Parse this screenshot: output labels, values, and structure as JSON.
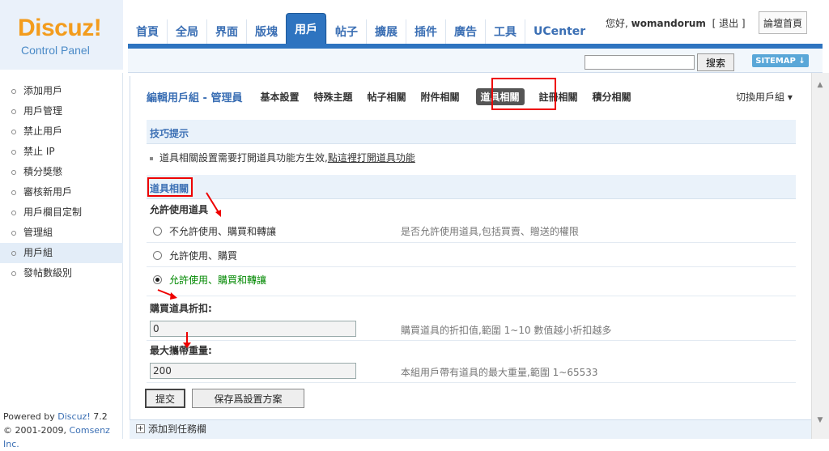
{
  "logo": {
    "brand": "Discuz!",
    "subtitle": "Control Panel"
  },
  "nav": {
    "items": [
      {
        "label": "首頁",
        "active": false
      },
      {
        "label": "全局",
        "active": false
      },
      {
        "label": "界面",
        "active": false
      },
      {
        "label": "版塊",
        "active": false
      },
      {
        "label": "用戶",
        "active": true
      },
      {
        "label": "帖子",
        "active": false
      },
      {
        "label": "擴展",
        "active": false
      },
      {
        "label": "插件",
        "active": false
      },
      {
        "label": "廣告",
        "active": false
      },
      {
        "label": "工具",
        "active": false
      },
      {
        "label": "UCenter",
        "active": false
      }
    ]
  },
  "user": {
    "greeting": "您好,",
    "name": "womandorum",
    "logout": "[ 退出 ]",
    "forum_home": "論壇首頁"
  },
  "search": {
    "value": "",
    "button": "搜索",
    "sitemap": "SITEMAP ↓"
  },
  "sidebar": {
    "items": [
      {
        "label": "添加用戶",
        "active": false
      },
      {
        "label": "用戶管理",
        "active": false
      },
      {
        "label": "禁止用戶",
        "active": false
      },
      {
        "label": "禁止 IP",
        "active": false
      },
      {
        "label": "積分獎懲",
        "active": false
      },
      {
        "label": "審核新用戶",
        "active": false
      },
      {
        "label": "用戶欄目定制",
        "active": false
      },
      {
        "label": "管理組",
        "active": false
      },
      {
        "label": "用戶組",
        "active": true
      },
      {
        "label": "發帖數級別",
        "active": false
      }
    ],
    "powered_prefix": "Powered by ",
    "powered_brand": "Discuz!",
    "powered_version": " 7.2",
    "copyright_prefix": "© 2001-2009, ",
    "copyright_company": "Comsenz Inc."
  },
  "main": {
    "title": "編輯用戶組 - 管理員",
    "tabs": [
      {
        "label": "基本設置",
        "active": false
      },
      {
        "label": "特殊主題",
        "active": false
      },
      {
        "label": "帖子相關",
        "active": false
      },
      {
        "label": "附件相關",
        "active": false
      },
      {
        "label": "道具相關",
        "active": true
      },
      {
        "label": "註冊相關",
        "active": false
      },
      {
        "label": "積分相關",
        "active": false
      }
    ],
    "switch_group": "切換用戶組 ▾",
    "tip_title": "技巧提示",
    "tip_text": "道具相關設置需要打開道具功能方生效,",
    "tip_link": "點這裡打開道具功能",
    "section_title": "道具相關",
    "allow_label": "允許使用道具",
    "options": [
      {
        "label": "不允許使用、購買和轉讓",
        "checked": false
      },
      {
        "label": "允許使用、購買",
        "checked": false
      },
      {
        "label": "允許使用、購買和轉讓",
        "checked": true
      }
    ],
    "allow_hint": "是否允許使用道具,包括買賣、贈送的權限",
    "discount_label": "購買道具折扣:",
    "discount_value": "0",
    "discount_hint": "購買道具的折扣值,範圍 1~10 數值越小折扣越多",
    "weight_label": "最大攜帶重量:",
    "weight_value": "200",
    "weight_hint": "本組用戶帶有道具的最大重量,範圍 1~65533",
    "submit": "提交",
    "save_scheme": "保存爲設置方案"
  },
  "bottom": {
    "add_task": "添加到任務欄"
  },
  "colors": {
    "accent": "#2e74c0",
    "logo_orange": "#f39c1d",
    "highlight": "#e00000"
  }
}
